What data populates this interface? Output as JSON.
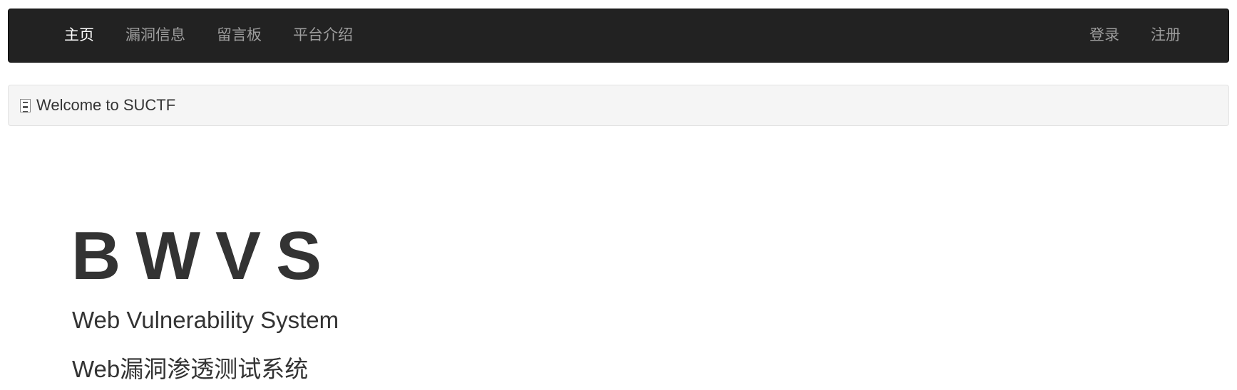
{
  "navbar": {
    "left_items": [
      {
        "label": "主页",
        "active": true
      },
      {
        "label": "漏洞信息",
        "active": false
      },
      {
        "label": "留言板",
        "active": false
      },
      {
        "label": "平台介绍",
        "active": false
      }
    ],
    "right_items": [
      {
        "label": "登录"
      },
      {
        "label": "注册"
      }
    ],
    "background_color": "#222222",
    "active_color": "#ffffff",
    "inactive_color": "#9d9d9d"
  },
  "welcome": {
    "icon": "broken-image-icon",
    "text": "Welcome to SUCTF"
  },
  "hero": {
    "title": "BWVS",
    "subtitle_en": "Web Vulnerability System",
    "subtitle_cn": "Web漏洞渗透测试系统"
  }
}
